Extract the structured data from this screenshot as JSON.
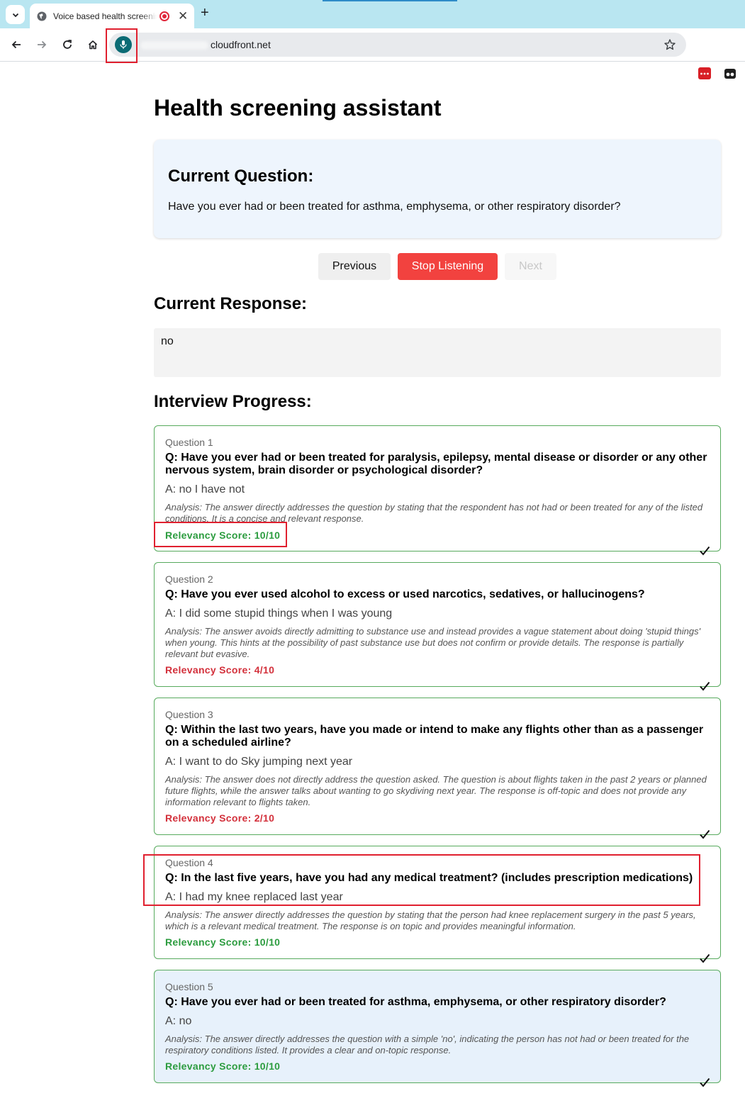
{
  "browser": {
    "tab_title": "Voice based health screening",
    "url": "cloudfront.net"
  },
  "page": {
    "title": "Health screening assistant",
    "current_question_heading": "Current Question:",
    "current_question_text": "Have you ever had or been treated for asthma, emphysema, or other respiratory disorder?",
    "buttons": {
      "previous": "Previous",
      "stop": "Stop Listening",
      "next": "Next"
    },
    "current_response_heading": "Current Response:",
    "current_response": "no",
    "progress_heading": "Interview Progress:"
  },
  "questions": [
    {
      "num": "Question 1",
      "q": "Q: Have you ever had or been treated for paralysis, epilepsy, mental disease or disorder or any other nervous system, brain disorder or psychological disorder?",
      "a": "A: no I have not",
      "analysis": "Analysis: The answer directly addresses the question by stating that the respondent has not had or been treated for any of the listed conditions. It is a concise and relevant response.",
      "score": "Relevancy Score: 10/10"
    },
    {
      "num": "Question 2",
      "q": "Q: Have you ever used alcohol to excess or used narcotics, sedatives, or hallucinogens?",
      "a": "A: I did some stupid things when I was young",
      "analysis": "Analysis: The answer avoids directly admitting to substance use and instead provides a vague statement about doing 'stupid things' when young. This hints at the possibility of past substance use but does not confirm or provide details. The response is partially relevant but evasive.",
      "score": "Relevancy Score: 4/10"
    },
    {
      "num": "Question 3",
      "q": "Q: Within the last two years, have you made or intend to make any flights other than as a passenger on a scheduled airline?",
      "a": "A: I want to do Sky jumping next year",
      "analysis": "Analysis: The answer does not directly address the question asked. The question is about flights taken in the past 2 years or planned future flights, while the answer talks about wanting to go skydiving next year. The response is off-topic and does not provide any information relevant to flights taken.",
      "score": "Relevancy Score: 2/10"
    },
    {
      "num": "Question 4",
      "q": "Q: In the last five years, have you had any medical treatment? (includes prescription medications)",
      "a": "A: I had my knee replaced last year",
      "analysis": "Analysis: The answer directly addresses the question by stating that the person had knee replacement surgery in the past 5 years, which is a relevant medical treatment. The response is on topic and provides meaningful information.",
      "score": "Relevancy Score: 10/10"
    },
    {
      "num": "Question 5",
      "q": "Q: Have you ever had or been treated for asthma, emphysema, or other respiratory disorder?",
      "a": "A: no",
      "analysis": "Analysis: The answer directly addresses the question with a simple 'no', indicating the person has not had or been treated for the respiratory conditions listed. It provides a clear and on-topic response.",
      "score": "Relevancy Score: 10/10"
    }
  ],
  "colors": {
    "good_score": "#2c9c3f",
    "bad_score": "#d3303b",
    "stop_button": "#f2423f",
    "card_border": "#57aa5d",
    "annotation": "#e0202f"
  }
}
